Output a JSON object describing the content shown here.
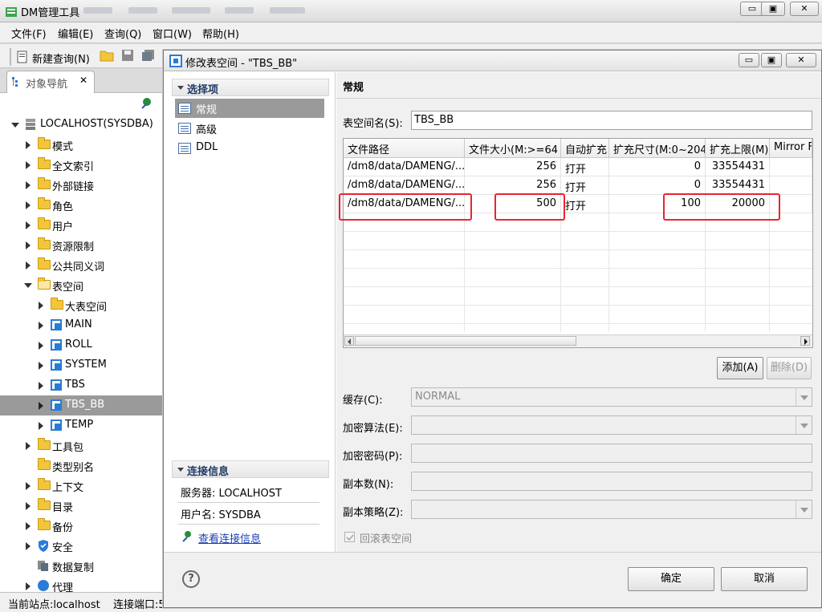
{
  "app": {
    "title": "DM管理工具",
    "menu": [
      "文件(F)",
      "编辑(E)",
      "查询(Q)",
      "窗口(W)",
      "帮助(H)"
    ],
    "toolbar": {
      "new_query": "新建查询(N)"
    },
    "window_buttons": {
      "minimize": "▭",
      "maximize": "▣",
      "close": "✕"
    }
  },
  "navigator": {
    "tab_label": "对象导航",
    "tab_close": "✕",
    "server": "LOCALHOST(SYSDBA)",
    "items": [
      {
        "label": "模式"
      },
      {
        "label": "全文索引"
      },
      {
        "label": "外部链接"
      },
      {
        "label": "角色"
      },
      {
        "label": "用户"
      },
      {
        "label": "资源限制"
      },
      {
        "label": "公共同义词"
      },
      {
        "label": "表空间"
      },
      {
        "label": "大表空间"
      },
      {
        "label": "MAIN"
      },
      {
        "label": "ROLL"
      },
      {
        "label": "SYSTEM"
      },
      {
        "label": "TBS"
      },
      {
        "label": "TBS_BB"
      },
      {
        "label": "TEMP"
      },
      {
        "label": "工具包"
      },
      {
        "label": "类型别名"
      },
      {
        "label": "上下文"
      },
      {
        "label": "目录"
      },
      {
        "label": "备份"
      },
      {
        "label": "安全"
      },
      {
        "label": "数据复制"
      },
      {
        "label": "代理"
      }
    ]
  },
  "statusbar": {
    "site": "当前站点:localhost",
    "port": "连接端口:5"
  },
  "dialog": {
    "title": "修改表空间 - \"TBS_BB\"",
    "left": {
      "select_heading": "选择项",
      "items": [
        "常规",
        "高级",
        "DDL"
      ],
      "conn_heading": "连接信息",
      "server": "服务器: LOCALHOST",
      "user": "用户名: SYSDBA",
      "view_conn_link": "查看连接信息"
    },
    "right": {
      "heading": "常规",
      "tablespace_name_label": "表空间名(S):",
      "tablespace_name_value": "TBS_BB",
      "columns": [
        "文件路径",
        "文件大小(M:>=64",
        "自动扩充",
        "扩充尺寸(M:0~204",
        "扩充上限(M)",
        "Mirror F"
      ],
      "rows": [
        [
          "/dm8/data/DAMENG/...",
          "256",
          "打开",
          "0",
          "33554431",
          ""
        ],
        [
          "/dm8/data/DAMENG/...",
          "256",
          "打开",
          "0",
          "33554431",
          ""
        ],
        [
          "/dm8/data/DAMENG/...",
          "500",
          "打开",
          "100",
          "20000",
          ""
        ]
      ],
      "add_button": "添加(A)",
      "delete_button": "删除(D)",
      "cache_label": "缓存(C):",
      "cache_value": "NORMAL",
      "encrypt_algo_label": "加密算法(E):",
      "encrypt_pwd_label": "加密密码(P):",
      "copies_label": "副本数(N):",
      "copy_policy_label": "副本策略(Z):",
      "rollback_label": "回滚表空间"
    },
    "footer": {
      "ok": "确定",
      "cancel": "取消",
      "help": "?"
    }
  },
  "colors": {
    "highlight_red": "#e8252f",
    "selection_gray": "#9a9a9a",
    "link_blue": "#1a3fb5"
  }
}
